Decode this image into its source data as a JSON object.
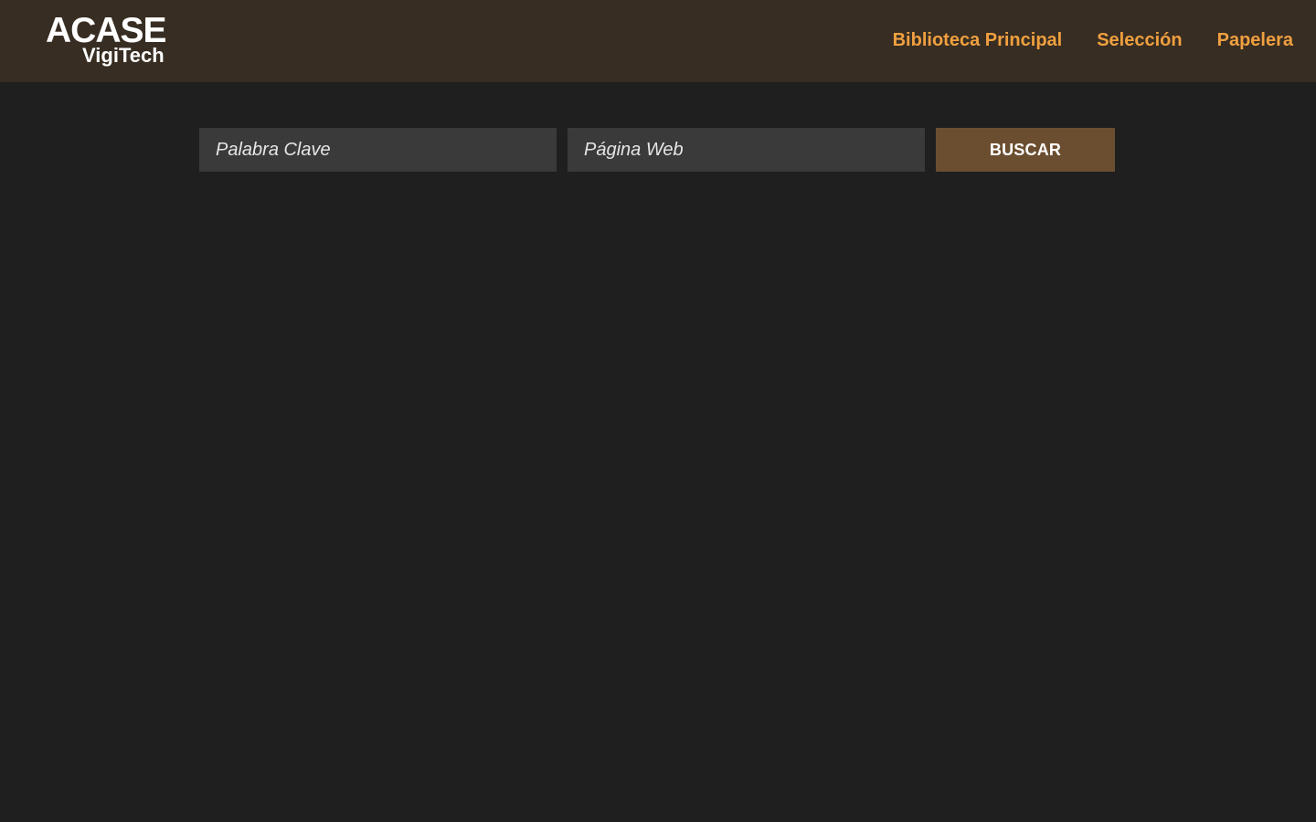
{
  "brand": {
    "name": "ACASE",
    "product": "VigiTech"
  },
  "nav": {
    "items": [
      {
        "label": "Biblioteca Principal"
      },
      {
        "label": "Selección"
      },
      {
        "label": "Papelera"
      }
    ]
  },
  "search": {
    "keyword_placeholder": "Palabra Clave",
    "keyword_value": "",
    "website_placeholder": "Página Web",
    "website_value": "",
    "button_label": "BUSCAR"
  },
  "colors": {
    "header_bg": "#372d22",
    "page_bg": "#1f1f1f",
    "nav_link": "#f0a040",
    "input_bg": "#3a3a3a",
    "button_bg": "#6b4e30"
  }
}
